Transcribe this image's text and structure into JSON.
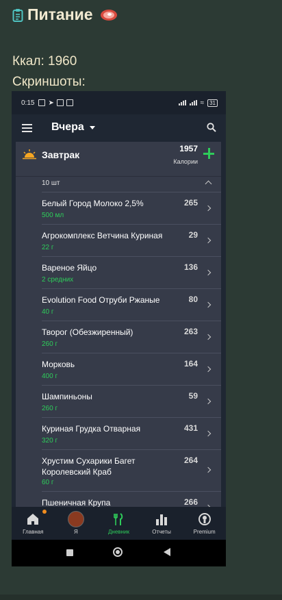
{
  "header": {
    "title": "Питание",
    "kcal_text": "Ккал: 1960",
    "screens_text": "Скриншоты:"
  },
  "phone": {
    "status": {
      "time": "0:15",
      "battery": "31"
    },
    "appbar": {
      "day": "Вчера"
    },
    "meal": {
      "name": "Завтрак",
      "calories": "1957",
      "calories_label": "Калории",
      "count": "10 шт"
    },
    "items": [
      {
        "name": "Белый Город Молоко 2,5%",
        "qty": "500 мл",
        "cal": "265"
      },
      {
        "name": "Агрокомплекс Ветчина Куриная",
        "qty": "22 г",
        "cal": "29"
      },
      {
        "name": "Вареное Яйцо",
        "qty": "2 средних",
        "cal": "136"
      },
      {
        "name": "Evolution Food Отруби Ржаные",
        "qty": "40 г",
        "cal": "80"
      },
      {
        "name": "Творог (Обезжиренный)",
        "qty": "260 г",
        "cal": "263"
      },
      {
        "name": "Морковь",
        "qty": "400 г",
        "cal": "164"
      },
      {
        "name": "Шампиньоны",
        "qty": "260 г",
        "cal": "59"
      },
      {
        "name": "Куриная Грудка Отварная",
        "qty": "320 г",
        "cal": "431"
      },
      {
        "name": "Хрустим Сухарики Багет Королевский Краб",
        "qty": "60 г",
        "cal": "264"
      },
      {
        "name": "Пшеничная Крупа",
        "qty": "",
        "cal": "266"
      }
    ],
    "tabs": [
      {
        "label": "Главная",
        "icon": "home-icon"
      },
      {
        "label": "Я",
        "icon": "avatar"
      },
      {
        "label": "Дневник",
        "icon": "fork-knife-icon"
      },
      {
        "label": "Отчеты",
        "icon": "bar-chart-icon"
      },
      {
        "label": "Premium",
        "icon": "premium-icon"
      }
    ]
  },
  "colors": {
    "accent_green": "#2ecc5a",
    "page_bg": "#2c3a34",
    "notif": "#f08c1e"
  }
}
